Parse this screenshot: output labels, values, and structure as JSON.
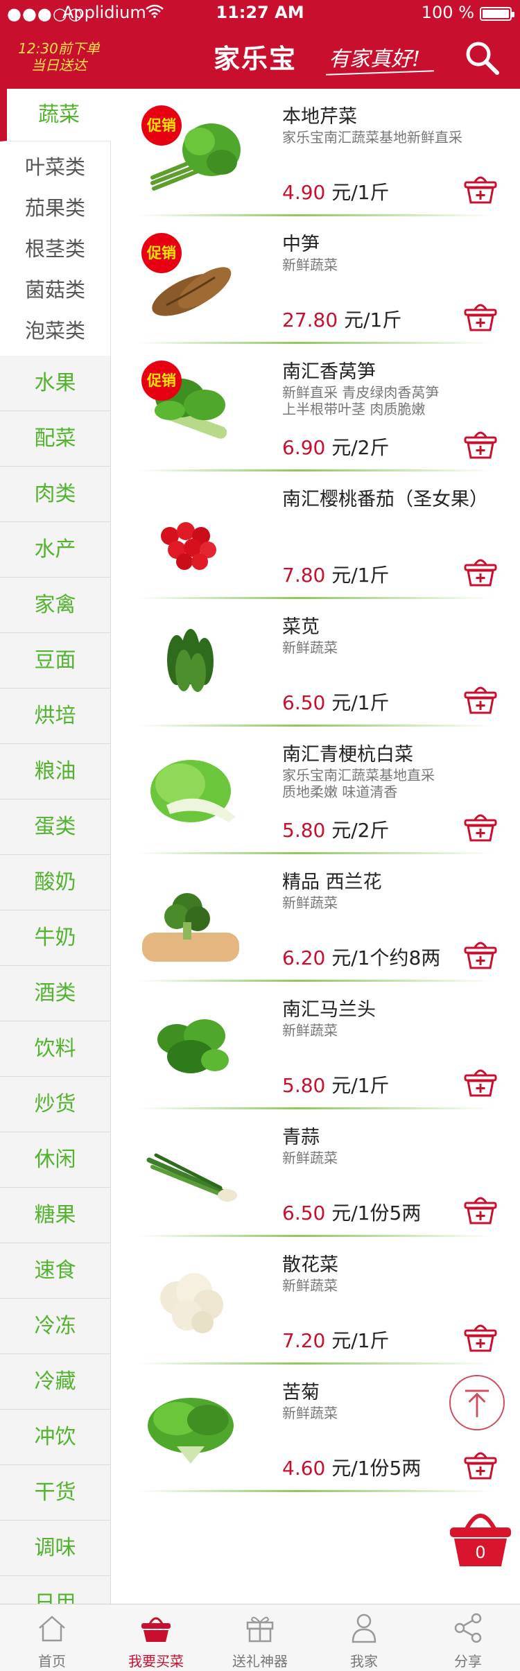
{
  "status_bar": {
    "signal": "●●●○○",
    "carrier": "Applidium",
    "time": "11:27 AM",
    "battery": "100 %"
  },
  "header": {
    "promo_line1": "12:30前下单",
    "promo_line2": "当日送达",
    "brand": "家乐宝",
    "slogan": "有家真好!"
  },
  "sidebar": {
    "active_category": "蔬菜",
    "subcategories": [
      "叶菜类",
      "茄果类",
      "根茎类",
      "菌菇类",
      "泡菜类"
    ],
    "categories": [
      "水果",
      "配菜",
      "肉类",
      "水产",
      "家禽",
      "豆面",
      "烘培",
      "粮油",
      "蛋类",
      "酸奶",
      "牛奶",
      "酒类",
      "饮料",
      "炒货",
      "休闲",
      "糖果",
      "速食",
      "冷冻",
      "冷藏",
      "冲饮",
      "干货",
      "调味",
      "日用"
    ]
  },
  "promo_badge": "促销",
  "products": [
    {
      "name": "本地芹菜",
      "desc": [
        "家乐宝南汇蔬菜基地新鲜直采"
      ],
      "price": "4.90",
      "unit": "元/1斤",
      "promo": true,
      "image": "celery"
    },
    {
      "name": "中笋",
      "desc": [
        "新鲜蔬菜"
      ],
      "price": "27.80",
      "unit": "元/1斤",
      "promo": true,
      "image": "bamboo-shoot"
    },
    {
      "name": "南汇香莴笋",
      "desc": [
        "新鲜直采 青皮绿肉香莴笋",
        "上半根带叶茎 肉质脆嫩"
      ],
      "price": "6.90",
      "unit": "元/2斤",
      "promo": true,
      "image": "lettuce-stem"
    },
    {
      "name": "南汇樱桃番茄（圣女果）",
      "desc": [],
      "price": "7.80",
      "unit": "元/1斤",
      "promo": false,
      "image": "cherry-tomato"
    },
    {
      "name": "菜苋",
      "desc": [
        "新鲜蔬菜"
      ],
      "price": "6.50",
      "unit": "元/1斤",
      "promo": false,
      "image": "amaranth"
    },
    {
      "name": "南汇青梗杭白菜",
      "desc": [
        "家乐宝南汇蔬菜基地直采",
        "质地柔嫩 味道清香"
      ],
      "price": "5.80",
      "unit": "元/2斤",
      "promo": false,
      "image": "bok-choy"
    },
    {
      "name": "精品 西兰花",
      "desc": [
        "新鲜蔬菜"
      ],
      "price": "6.20",
      "unit": "元/1个约8两",
      "promo": false,
      "image": "broccoli"
    },
    {
      "name": "南汇马兰头",
      "desc": [
        "新鲜蔬菜"
      ],
      "price": "5.80",
      "unit": "元/1斤",
      "promo": false,
      "image": "malantou"
    },
    {
      "name": "青蒜",
      "desc": [
        "新鲜蔬菜"
      ],
      "price": "6.50",
      "unit": "元/1份5两",
      "promo": false,
      "image": "green-garlic"
    },
    {
      "name": "散花菜",
      "desc": [
        "新鲜蔬菜"
      ],
      "price": "7.20",
      "unit": "元/1斤",
      "promo": false,
      "image": "cauliflower"
    },
    {
      "name": "苦菊",
      "desc": [
        "新鲜蔬菜"
      ],
      "price": "4.60",
      "unit": "元/1份5两",
      "promo": false,
      "image": "endive"
    }
  ],
  "cart": {
    "count": "0"
  },
  "tabs": [
    {
      "label": "首页",
      "icon": "home-icon",
      "active": false
    },
    {
      "label": "我要买菜",
      "icon": "basket-icon",
      "active": true
    },
    {
      "label": "送礼神器",
      "icon": "gift-icon",
      "active": false
    },
    {
      "label": "我家",
      "icon": "user-icon",
      "active": false
    },
    {
      "label": "分享",
      "icon": "share-icon",
      "active": false
    }
  ],
  "colors": {
    "brand_red": "#c8102e",
    "category_green": "#53b32f",
    "price_red": "#c8102e",
    "promo_yellow": "#ffe34d"
  }
}
